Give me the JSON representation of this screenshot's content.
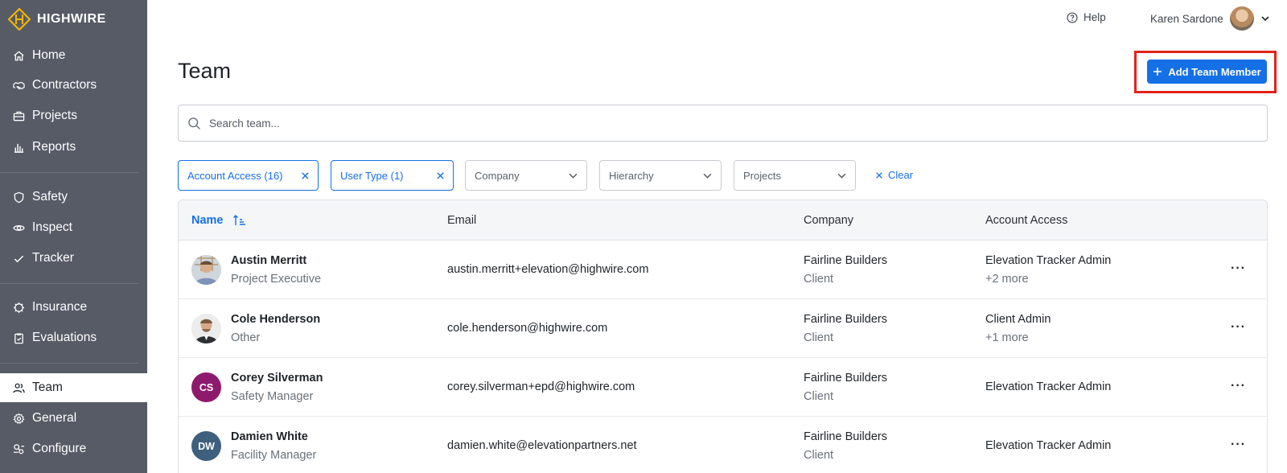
{
  "brand": {
    "name": "HIGHWIRE",
    "accent": "#f2b705"
  },
  "sidebar": {
    "items": [
      {
        "label": "Home",
        "icon": "home-icon"
      },
      {
        "label": "Contractors",
        "icon": "handshake-icon"
      },
      {
        "label": "Projects",
        "icon": "briefcase-icon"
      },
      {
        "label": "Reports",
        "icon": "bar-chart-icon"
      },
      {
        "label": "Safety",
        "icon": "shield-icon"
      },
      {
        "label": "Inspect",
        "icon": "eye-icon"
      },
      {
        "label": "Tracker",
        "icon": "check-icon"
      },
      {
        "label": "Insurance",
        "icon": "gear-badge-icon"
      },
      {
        "label": "Evaluations",
        "icon": "clipboard-icon"
      },
      {
        "label": "Team",
        "icon": "users-icon",
        "active": true
      },
      {
        "label": "General",
        "icon": "settings-icon"
      },
      {
        "label": "Configure",
        "icon": "configure-icon"
      }
    ]
  },
  "topbar": {
    "help_label": "Help",
    "user_name": "Karen Sardone"
  },
  "page": {
    "title": "Team",
    "add_button_label": "Add Team Member"
  },
  "search": {
    "placeholder": "Search team..."
  },
  "filters": {
    "chips": [
      {
        "label": "Account Access (16)",
        "selected": true
      },
      {
        "label": "User Type (1)",
        "selected": true
      },
      {
        "label": "Company",
        "selected": false
      },
      {
        "label": "Hierarchy",
        "selected": false
      },
      {
        "label": "Projects",
        "selected": false
      }
    ],
    "clear_label": "Clear"
  },
  "table": {
    "columns": [
      "Name",
      "Email",
      "Company",
      "Account Access"
    ],
    "rows": [
      {
        "name": "Austin Merritt",
        "role": "Project Executive",
        "email": "austin.merritt+elevation@highwire.com",
        "company": "Fairline Builders",
        "company_type": "Client",
        "access": "Elevation Tracker Admin",
        "more": "+2 more",
        "avatar_type": "photo"
      },
      {
        "name": "Cole Henderson",
        "role": "Other",
        "email": "cole.henderson@highwire.com",
        "company": "Fairline Builders",
        "company_type": "Client",
        "access": "Client Admin",
        "more": "+1 more",
        "avatar_type": "photo"
      },
      {
        "name": "Corey Silverman",
        "role": "Safety Manager",
        "email": "corey.silverman+epd@highwire.com",
        "company": "Fairline Builders",
        "company_type": "Client",
        "access": "Elevation Tracker Admin",
        "more": "",
        "avatar_type": "initials",
        "initials": "CS",
        "color": "#8e1a6e"
      },
      {
        "name": "Damien White",
        "role": "Facility Manager",
        "email": "damien.white@elevationpartners.net",
        "company": "Fairline Builders",
        "company_type": "Client",
        "access": "Elevation Tracker Admin",
        "more": "",
        "avatar_type": "initials",
        "initials": "DW",
        "color": "#3e5f7e"
      }
    ]
  },
  "colors": {
    "primary": "#1570e6",
    "sidebar_bg": "#565b66",
    "highlight": "#e2231a"
  }
}
